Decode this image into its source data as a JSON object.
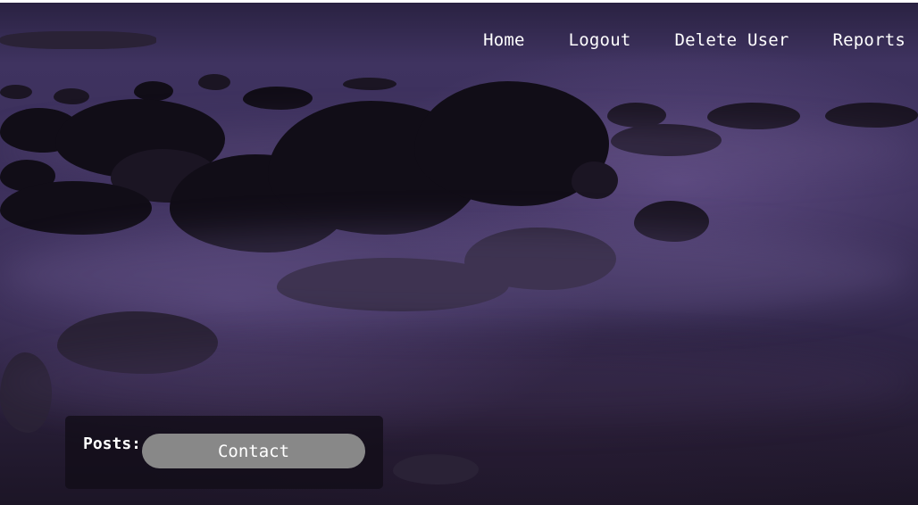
{
  "nav": {
    "items": [
      {
        "label": "Home"
      },
      {
        "label": "Logout"
      },
      {
        "label": "Delete User"
      },
      {
        "label": "Reports"
      }
    ]
  },
  "panel": {
    "posts_label": "Posts:",
    "contact_label": "Contact"
  },
  "background": {
    "description_icon": "misty-rocks-background",
    "colors": {
      "tint": "#3b2f5a",
      "rock": "#110d17"
    }
  }
}
